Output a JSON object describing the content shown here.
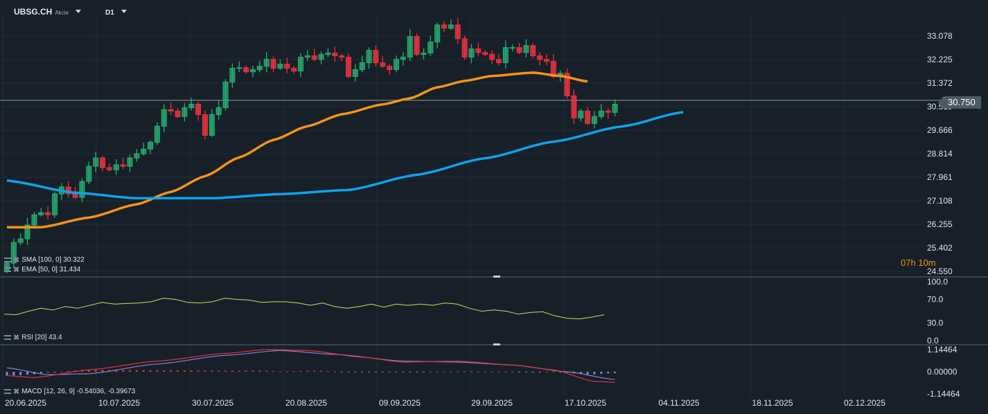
{
  "header": {
    "symbol": "UBSG.CH",
    "type": "Akcie",
    "timeframe": "D1"
  },
  "colors": {
    "bg": "#172028",
    "up": "#26b074",
    "down": "#e8323e",
    "ema": "#f7931a",
    "sma": "#0fa3ec",
    "rsi": "#d6d96a",
    "macd": "#e8323e",
    "signal": "#7f86d6",
    "hist_pos": "#e8323e",
    "hist_neg": "#7f86d6"
  },
  "countdown": "07h 10m",
  "last_price": "30.750",
  "indicators": {
    "sma": "SMA [100, 0] 30.322",
    "ema": "EMA [50, 0] 31.434",
    "rsi": "RSI [20]  43.4",
    "macd": "MACD [12, 26, 9] -0.54036,  -0.39673"
  },
  "chart_data": [
    {
      "type": "candlestick",
      "price_ticks": [
        "33.078",
        "32.225",
        "31.372",
        "30.519",
        "29.666",
        "28.814",
        "27.961",
        "27.108",
        "26.255",
        "25.402",
        "24.550"
      ],
      "ylim": [
        24.55,
        33.078
      ],
      "x_ticks": [
        "20.06.2025",
        "10.07.2025",
        "30.07.2025",
        "20.08.2025",
        "09.09.2025",
        "29.09.2025",
        "17.10.2025",
        "04.11.2025",
        "18.11.2025",
        "02.12.2025"
      ],
      "closes": [
        24.85,
        25.6,
        25.73,
        26.23,
        26.6,
        26.68,
        26.6,
        27.36,
        27.61,
        27.36,
        27.23,
        27.81,
        28.36,
        28.66,
        28.31,
        28.23,
        28.41,
        28.36,
        28.66,
        28.81,
        28.98,
        29.23,
        29.81,
        30.41,
        30.36,
        30.16,
        30.48,
        30.61,
        30.23,
        29.48,
        30.23,
        30.48,
        31.41,
        31.91,
        31.93,
        31.78,
        31.86,
        31.98,
        32.23,
        31.91,
        32.06,
        31.91,
        31.81,
        32.31,
        32.36,
        32.23,
        32.41,
        32.46,
        32.36,
        32.31,
        31.61,
        31.86,
        32.11,
        32.56,
        32.11,
        31.98,
        31.86,
        32.23,
        32.31,
        33.06,
        32.41,
        32.46,
        32.86,
        33.48,
        33.36,
        33.48,
        32.98,
        32.31,
        32.61,
        32.48,
        32.41,
        32.23,
        32.11,
        32.66,
        32.66,
        32.48,
        32.73,
        32.36,
        32.23,
        32.16,
        31.61,
        31.73,
        30.91,
        30.11,
        30.36,
        29.91,
        30.16,
        30.36,
        30.31,
        30.61
      ],
      "sma": [
        [
          0,
          27.84
        ],
        [
          10,
          27.4
        ],
        [
          19,
          27.2
        ],
        [
          30,
          27.2
        ],
        [
          40,
          27.35
        ],
        [
          50,
          27.5
        ],
        [
          60,
          28.05
        ],
        [
          70,
          28.65
        ],
        [
          80,
          29.25
        ],
        [
          90,
          29.8
        ],
        [
          99,
          30.32
        ]
      ],
      "ema": [
        [
          0,
          26.15
        ],
        [
          5,
          26.15
        ],
        [
          12,
          26.5
        ],
        [
          19,
          26.98
        ],
        [
          24,
          27.43
        ],
        [
          29,
          28.0
        ],
        [
          34,
          28.68
        ],
        [
          39,
          29.31
        ],
        [
          44,
          29.81
        ],
        [
          49,
          30.24
        ],
        [
          55,
          30.6
        ],
        [
          59,
          30.82
        ],
        [
          63,
          31.22
        ],
        [
          67,
          31.45
        ],
        [
          71,
          31.63
        ],
        [
          77,
          31.75
        ],
        [
          81,
          31.63
        ],
        [
          85,
          31.43
        ]
      ],
      "rsi": [
        45,
        44,
        50,
        55,
        52,
        58,
        55,
        60,
        65,
        62,
        63,
        64,
        66,
        72,
        70,
        65,
        64,
        66,
        72,
        70,
        69,
        65,
        66,
        66,
        64,
        60,
        64,
        58,
        55,
        58,
        62,
        57,
        62,
        60,
        62,
        60,
        64,
        62,
        55,
        50,
        52,
        50,
        45,
        48,
        49,
        42,
        38,
        37,
        40,
        44
      ],
      "rsi_levels": [
        "100.0",
        "70.0",
        "30.0",
        "0.0"
      ],
      "macd_ticks": [
        "1.14464",
        "0.00000",
        "-1.14464"
      ],
      "macd": [
        [
          0,
          -0.2
        ],
        [
          4,
          -0.3
        ],
        [
          12,
          0.1
        ],
        [
          22,
          0.55
        ],
        [
          32,
          0.95
        ],
        [
          38,
          1.15
        ],
        [
          44,
          1.1
        ],
        [
          52,
          0.75
        ],
        [
          58,
          0.5
        ],
        [
          66,
          0.55
        ],
        [
          74,
          0.35
        ],
        [
          80,
          0.1
        ],
        [
          86,
          -0.5
        ],
        [
          89,
          -0.54
        ]
      ],
      "signal": [
        [
          0,
          0.2
        ],
        [
          6,
          -0.15
        ],
        [
          12,
          -0.1
        ],
        [
          22,
          0.4
        ],
        [
          32,
          0.85
        ],
        [
          40,
          1.1
        ],
        [
          48,
          0.9
        ],
        [
          58,
          0.55
        ],
        [
          66,
          0.5
        ],
        [
          74,
          0.35
        ],
        [
          82,
          0.0
        ],
        [
          89,
          -0.4
        ]
      ]
    }
  ]
}
